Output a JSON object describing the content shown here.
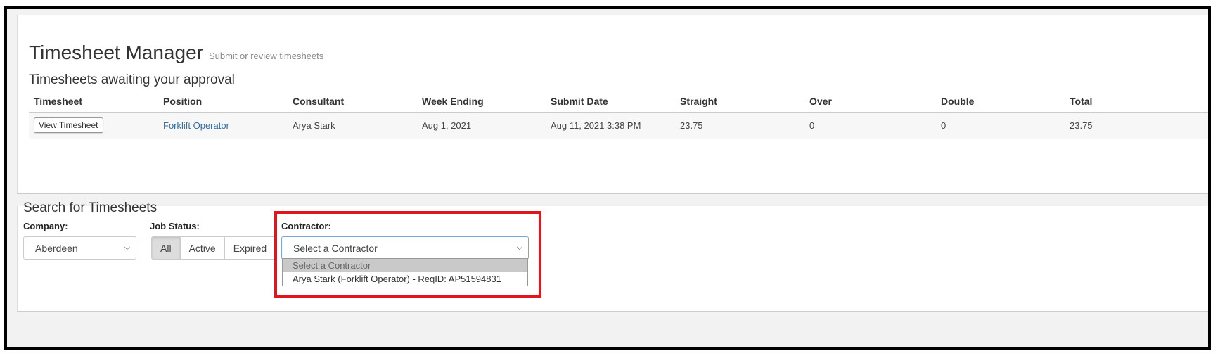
{
  "header": {
    "title": "Timesheet Manager",
    "subtitle": "Submit or review timesheets"
  },
  "approval": {
    "section_title": "Timesheets awaiting your approval",
    "columns": [
      "Timesheet",
      "Position",
      "Consultant",
      "Week Ending",
      "Submit Date",
      "Straight",
      "Over",
      "Double",
      "Total"
    ],
    "rows": [
      {
        "timesheet_button": "View Timesheet",
        "position": "Forklift Operator",
        "consultant": "Arya Stark",
        "week_ending": "Aug 1, 2021",
        "submit_date": "Aug 11, 2021 3:38 PM",
        "straight": "23.75",
        "over": "0",
        "double": "0",
        "total": "23.75"
      }
    ]
  },
  "search": {
    "section_title": "Search for Timesheets",
    "company_label": "Company:",
    "company_value": "Aberdeen",
    "job_status_label": "Job Status:",
    "job_status_options": [
      "All",
      "Active",
      "Expired"
    ],
    "job_status_selected": "All",
    "contractor_label": "Contractor:",
    "contractor_value": "Select a Contractor",
    "contractor_options": [
      "Select a Contractor",
      "Arya Stark (Forklift Operator) - ReqID: AP51594831"
    ]
  },
  "colors": {
    "highlight": "#e3141c",
    "link": "#2f6ea8",
    "panel_bg": "#f2f2f2"
  },
  "icons": {
    "select_chevron": "chevron-down-icon"
  }
}
